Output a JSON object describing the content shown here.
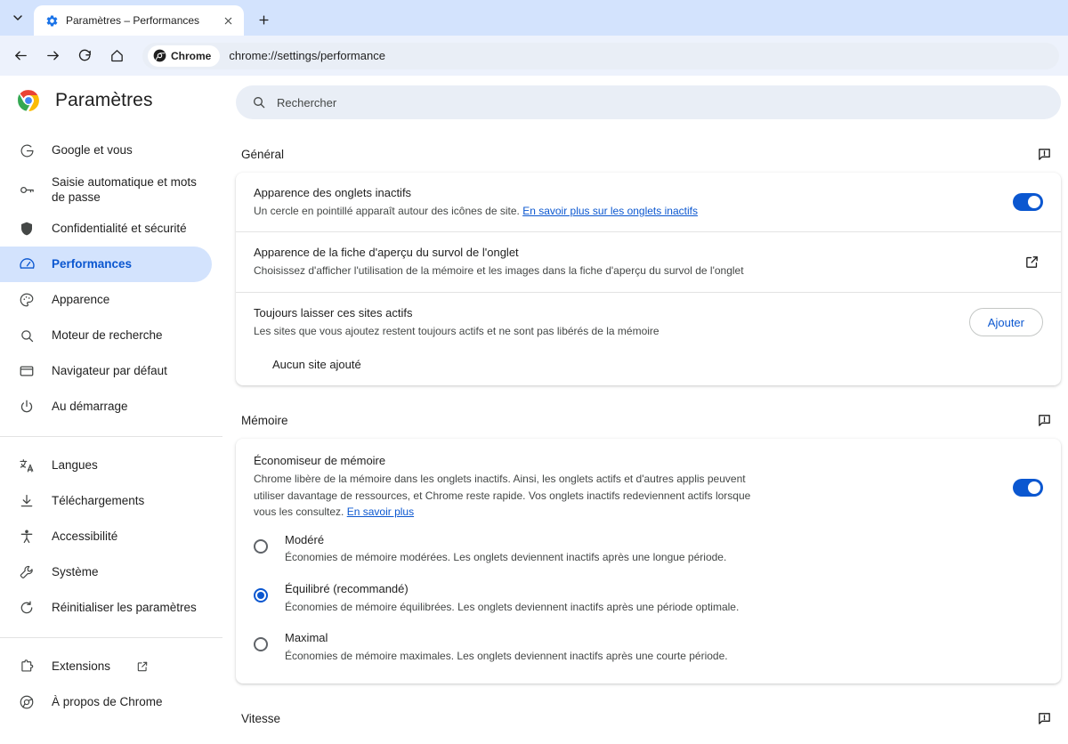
{
  "browser": {
    "tab": {
      "title": "Paramètres – Performances",
      "favicon_icon": "gear-icon",
      "close_icon": "close-icon"
    },
    "tabstrip": {
      "chevron_icon": "chevron-down-icon",
      "new_tab_icon": "plus-icon"
    },
    "toolbar": {
      "back_icon": "arrow-left-icon",
      "forward_icon": "arrow-right-icon",
      "reload_icon": "reload-icon",
      "home_icon": "home-icon",
      "chip_label": "Chrome",
      "chip_icon": "chrome-icon",
      "url": "chrome://settings/performance"
    }
  },
  "sidebar": {
    "brand": "Paramètres",
    "brand_icon": "chrome-logo-icon",
    "items": [
      {
        "label": "Google et vous",
        "icon": "google-g-icon",
        "active": false
      },
      {
        "label": "Saisie automatique et mots de passe",
        "icon": "key-icon",
        "active": false
      },
      {
        "label": "Confidentialité et sécurité",
        "icon": "shield-icon",
        "active": false
      },
      {
        "label": "Performances",
        "icon": "speedometer-icon",
        "active": true
      },
      {
        "label": "Apparence",
        "icon": "palette-icon",
        "active": false
      },
      {
        "label": "Moteur de recherche",
        "icon": "search-icon",
        "active": false
      },
      {
        "label": "Navigateur par défaut",
        "icon": "browser-window-icon",
        "active": false
      },
      {
        "label": "Au démarrage",
        "icon": "power-icon",
        "active": false
      }
    ],
    "items_group2": [
      {
        "label": "Langues",
        "icon": "translate-icon"
      },
      {
        "label": "Téléchargements",
        "icon": "download-icon"
      },
      {
        "label": "Accessibilité",
        "icon": "accessibility-icon"
      },
      {
        "label": "Système",
        "icon": "wrench-icon"
      },
      {
        "label": "Réinitialiser les paramètres",
        "icon": "restore-icon"
      }
    ],
    "items_group3": [
      {
        "label": "Extensions",
        "icon": "puzzle-icon",
        "external": true,
        "external_icon": "external-link-icon"
      },
      {
        "label": "À propos de Chrome",
        "icon": "chrome-outline-icon",
        "external": false
      }
    ]
  },
  "search": {
    "placeholder": "Rechercher",
    "icon": "search-icon"
  },
  "sections": {
    "general": {
      "title": "Général",
      "feedback_icon": "feedback-icon",
      "rows": {
        "inactive_tabs": {
          "title": "Apparence des onglets inactifs",
          "sub_prefix": "Un cercle en pointillé apparaît autour des icônes de site. ",
          "link": "En savoir plus sur les onglets inactifs",
          "toggle_on": true
        },
        "hover_card": {
          "title": "Apparence de la fiche d'aperçu du survol de l'onglet",
          "sub": "Choisissez d'afficher l'utilisation de la mémoire et les images dans la fiche d'aperçu du survol de l'onglet",
          "action_icon": "external-link-icon"
        },
        "always_active_sites": {
          "title": "Toujours laisser ces sites actifs",
          "sub": "Les sites que vous ajoutez restent toujours actifs et ne sont pas libérés de la mémoire",
          "button": "Ajouter",
          "empty_text": "Aucun site ajouté"
        }
      }
    },
    "memory": {
      "title": "Mémoire",
      "feedback_icon": "feedback-icon",
      "saver": {
        "title": "Économiseur de mémoire",
        "sub_prefix": "Chrome libère de la mémoire dans les onglets inactifs. Ainsi, les onglets actifs et d'autres applis peuvent utiliser davantage de ressources, et Chrome reste rapide. Vos onglets inactifs redeviennent actifs lorsque vous les consultez. ",
        "link": "En savoir plus",
        "toggle_on": true
      },
      "options": [
        {
          "label": "Modéré",
          "sub": "Économies de mémoire modérées. Les onglets deviennent inactifs après une longue période.",
          "selected": false
        },
        {
          "label": "Équilibré (recommandé)",
          "sub": "Économies de mémoire équilibrées. Les onglets deviennent inactifs après une période optimale.",
          "selected": true
        },
        {
          "label": "Maximal",
          "sub": "Économies de mémoire maximales. Les onglets deviennent inactifs après une courte période.",
          "selected": false
        }
      ]
    },
    "speed": {
      "title": "Vitesse",
      "feedback_icon": "feedback-icon"
    }
  },
  "colors": {
    "accent": "#0b57d0",
    "tabstrip_bg": "#d3e3fd",
    "toolbar_bg": "#edf2fc",
    "active_nav_bg": "#d3e3fd",
    "search_bg": "#e9eef6"
  }
}
